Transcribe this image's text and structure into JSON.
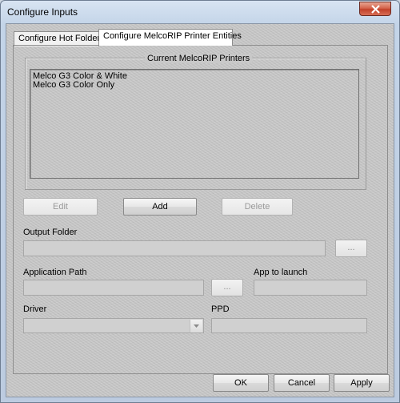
{
  "window": {
    "title": "Configure Inputs"
  },
  "tabs": [
    {
      "label": "Configure Hot Folders"
    },
    {
      "label": "Configure MelcoRIP Printer Entities"
    }
  ],
  "printers": {
    "group_label": "Current MelcoRIP Printers",
    "items": [
      "Melco G3 Color & White",
      "Melco G3 Color Only"
    ]
  },
  "actions": {
    "edit": "Edit",
    "add": "Add",
    "delete": "Delete"
  },
  "fields": {
    "output_folder": {
      "label": "Output Folder",
      "value": "",
      "browse": "..."
    },
    "application_path": {
      "label": "Application Path",
      "value": "",
      "browse": "..."
    },
    "app_to_launch": {
      "label": "App to launch",
      "value": ""
    },
    "driver": {
      "label": "Driver",
      "value": ""
    },
    "ppd": {
      "label": "PPD",
      "value": ""
    }
  },
  "dialog_buttons": {
    "ok": "OK",
    "cancel": "Cancel",
    "apply": "Apply"
  },
  "colors": {
    "close_button": "#c2412a",
    "frame": "#c3d4e8",
    "panel": "#c8c8c8"
  }
}
